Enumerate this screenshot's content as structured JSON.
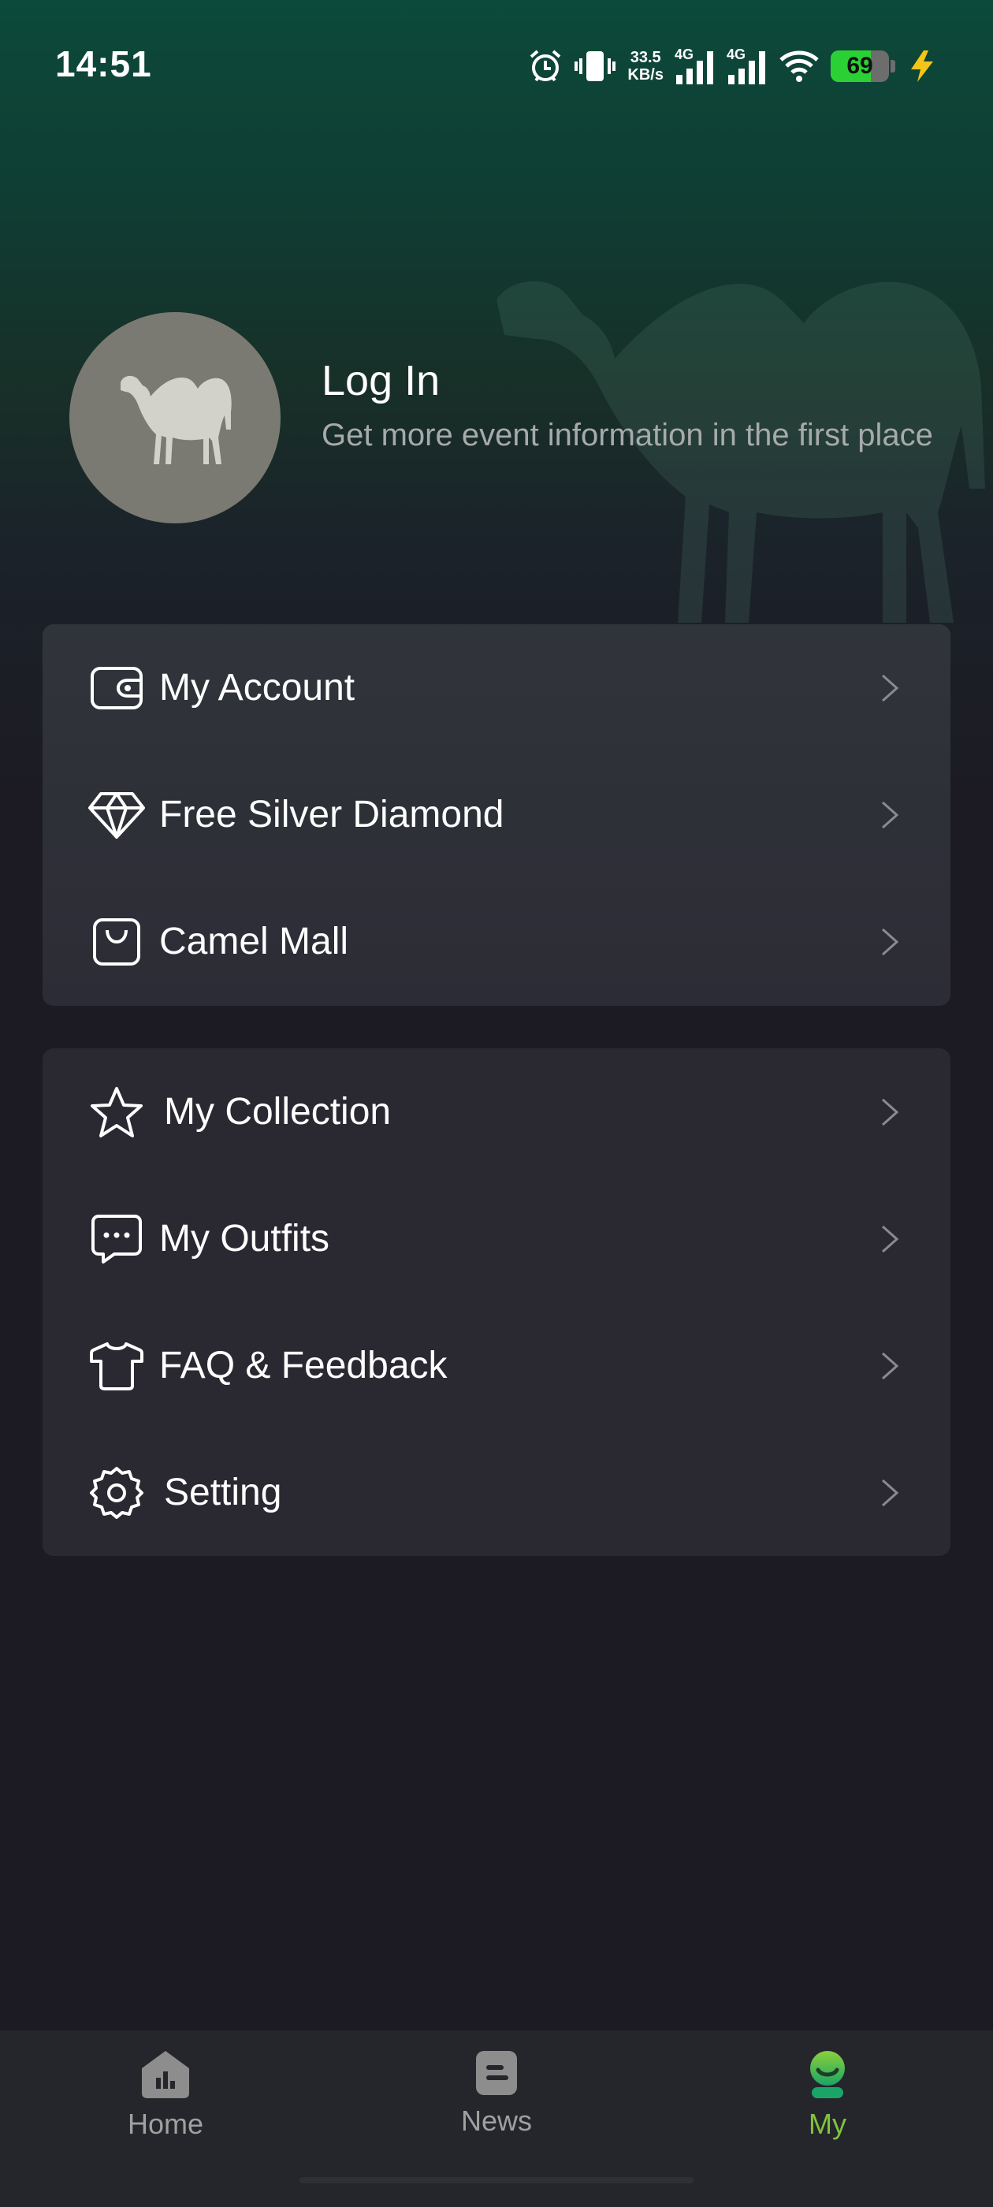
{
  "status_bar": {
    "time": "14:51",
    "net_speed_value": "33.5",
    "net_speed_unit": "KB/s",
    "signal1_label": "4G",
    "signal2_label": "4G",
    "battery_level": "69",
    "icons": [
      "alarm-icon",
      "vibrate-icon",
      "signal-icon",
      "signal-icon",
      "wifi-icon",
      "battery-icon",
      "charging-icon"
    ]
  },
  "profile": {
    "title": "Log In",
    "subtitle": "Get more event information in the first place"
  },
  "menu_group_1": [
    {
      "label": "My Account",
      "icon": "wallet-icon"
    },
    {
      "label": "Free Silver Diamond",
      "icon": "diamond-icon"
    },
    {
      "label": "Camel Mall",
      "icon": "shopping-bag-icon"
    }
  ],
  "menu_group_2": [
    {
      "label": "My Collection",
      "icon": "star-icon"
    },
    {
      "label": "My Outfits",
      "icon": "chat-bubble-icon"
    },
    {
      "label": "FAQ & Feedback",
      "icon": "tshirt-icon"
    },
    {
      "label": "Setting",
      "icon": "gear-icon"
    }
  ],
  "bottom_nav": {
    "items": [
      {
        "label": "Home",
        "icon": "home-icon"
      },
      {
        "label": "News",
        "icon": "news-icon"
      },
      {
        "label": "My",
        "icon": "profile-icon"
      }
    ],
    "active": "My"
  },
  "colors": {
    "accent": "#7fc43a",
    "background": "#1c1b23",
    "card": "#2a2932",
    "header_green": "#0c4a3a"
  }
}
